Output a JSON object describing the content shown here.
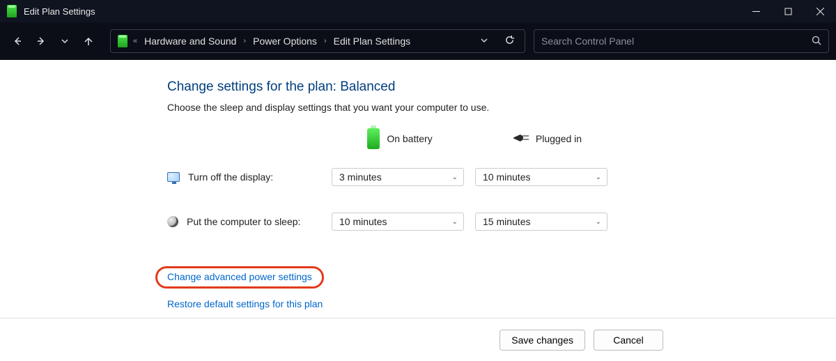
{
  "window": {
    "title": "Edit Plan Settings"
  },
  "breadcrumbs": {
    "ellipsis": "«",
    "items": [
      "Hardware and Sound",
      "Power Options",
      "Edit Plan Settings"
    ]
  },
  "search": {
    "placeholder": "Search Control Panel"
  },
  "page": {
    "heading": "Change settings for the plan: Balanced",
    "subheading": "Choose the sleep and display settings that you want your computer to use.",
    "col_battery": "On battery",
    "col_plugged": "Plugged in",
    "rows": {
      "display": {
        "label": "Turn off the display:",
        "battery": "3 minutes",
        "plugged": "10 minutes"
      },
      "sleep": {
        "label": "Put the computer to sleep:",
        "battery": "10 minutes",
        "plugged": "15 minutes"
      }
    },
    "links": {
      "advanced": "Change advanced power settings",
      "restore": "Restore default settings for this plan"
    }
  },
  "footer": {
    "save": "Save changes",
    "cancel": "Cancel"
  }
}
